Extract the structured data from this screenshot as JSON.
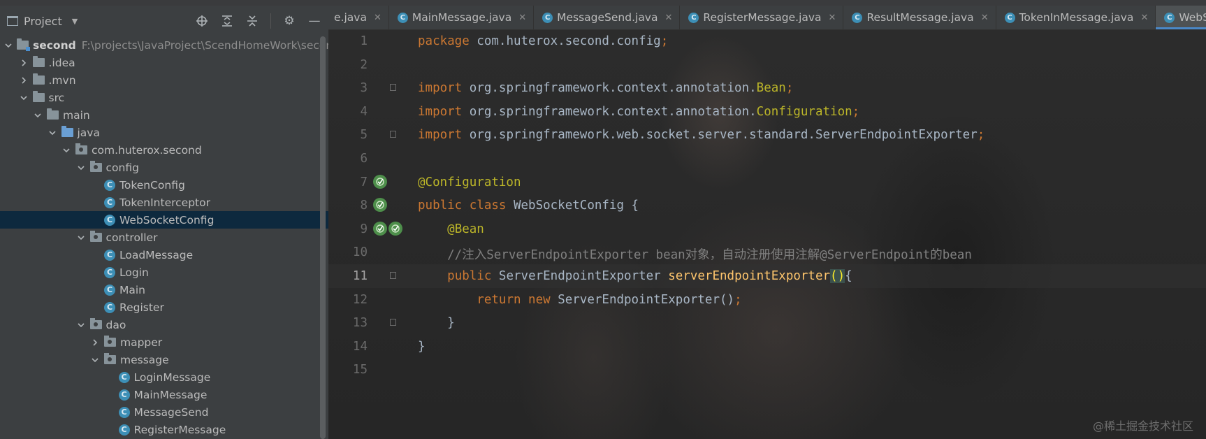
{
  "project_panel": {
    "title": "Project",
    "tree": [
      {
        "label": "second",
        "path": "F:\\projects\\JavaProject\\ScendHomeWork\\second",
        "depth": 0,
        "icon": "module-folder",
        "expanded": true,
        "bold": true
      },
      {
        "label": ".idea",
        "depth": 1,
        "icon": "folder",
        "expanded": false
      },
      {
        "label": ".mvn",
        "depth": 1,
        "icon": "folder",
        "expanded": false
      },
      {
        "label": "src",
        "depth": 1,
        "icon": "folder",
        "expanded": true
      },
      {
        "label": "main",
        "depth": 2,
        "icon": "folder",
        "expanded": true
      },
      {
        "label": "java",
        "depth": 3,
        "icon": "source-folder",
        "expanded": true
      },
      {
        "label": "com.huterox.second",
        "depth": 4,
        "icon": "package",
        "expanded": true
      },
      {
        "label": "config",
        "depth": 5,
        "icon": "package",
        "expanded": true
      },
      {
        "label": "TokenConfig",
        "depth": 6,
        "icon": "class"
      },
      {
        "label": "TokenInterceptor",
        "depth": 6,
        "icon": "class"
      },
      {
        "label": "WebSocketConfig",
        "depth": 6,
        "icon": "class",
        "selected": true
      },
      {
        "label": "controller",
        "depth": 5,
        "icon": "package",
        "expanded": true
      },
      {
        "label": "LoadMessage",
        "depth": 6,
        "icon": "class"
      },
      {
        "label": "Login",
        "depth": 6,
        "icon": "class"
      },
      {
        "label": "Main",
        "depth": 6,
        "icon": "class"
      },
      {
        "label": "Register",
        "depth": 6,
        "icon": "class"
      },
      {
        "label": "dao",
        "depth": 5,
        "icon": "package",
        "expanded": true
      },
      {
        "label": "mapper",
        "depth": 6,
        "icon": "package",
        "expanded": false
      },
      {
        "label": "message",
        "depth": 6,
        "icon": "package",
        "expanded": true
      },
      {
        "label": "LoginMessage",
        "depth": 7,
        "icon": "class"
      },
      {
        "label": "MainMessage",
        "depth": 7,
        "icon": "class"
      },
      {
        "label": "MessageSend",
        "depth": 7,
        "icon": "class"
      },
      {
        "label": "RegisterMessage",
        "depth": 7,
        "icon": "class"
      }
    ]
  },
  "editor": {
    "tabs": [
      {
        "label": "e.java",
        "cut": true
      },
      {
        "label": "MainMessage.java"
      },
      {
        "label": "MessageSend.java"
      },
      {
        "label": "RegisterMessage.java"
      },
      {
        "label": "ResultMessage.java"
      },
      {
        "label": "TokenInMessage.java"
      },
      {
        "label": "WebSocketC",
        "active": true
      }
    ],
    "code": [
      {
        "n": "1",
        "parts": [
          [
            "kw",
            "package "
          ],
          [
            "tp",
            "com.huterox.second.config"
          ],
          [
            "kw",
            ";"
          ]
        ]
      },
      {
        "n": "2",
        "parts": []
      },
      {
        "n": "3",
        "fold": true,
        "parts": [
          [
            "kw",
            "import "
          ],
          [
            "tp",
            "org.springframework.context.annotation."
          ],
          [
            "ann",
            "Bean"
          ],
          [
            "kw",
            ";"
          ]
        ]
      },
      {
        "n": "4",
        "parts": [
          [
            "kw",
            "import "
          ],
          [
            "tp",
            "org.springframework.context.annotation."
          ],
          [
            "ann",
            "Configuration"
          ],
          [
            "kw",
            ";"
          ]
        ]
      },
      {
        "n": "5",
        "fold": true,
        "parts": [
          [
            "kw",
            "import "
          ],
          [
            "tp",
            "org.springframework.web.socket.server.standard.ServerEndpointExporter"
          ],
          [
            "kw",
            ";"
          ]
        ]
      },
      {
        "n": "6",
        "parts": []
      },
      {
        "n": "7",
        "gutter": "config",
        "parts": [
          [
            "ann",
            "@Configuration"
          ]
        ]
      },
      {
        "n": "8",
        "gutter": "bean-class",
        "parts": [
          [
            "kw",
            "public class "
          ],
          [
            "tp",
            "WebSocketConfig {"
          ]
        ]
      },
      {
        "n": "9",
        "gutter": "method",
        "parts": [
          [
            "tp",
            "    "
          ],
          [
            "ann",
            "@Bean"
          ]
        ]
      },
      {
        "n": "10",
        "parts": [
          [
            "cm",
            "    //注入ServerEndpointExporter bean对象，自动注册使用注解@ServerEndpoint的bean"
          ]
        ]
      },
      {
        "n": "11",
        "fold": true,
        "current": true,
        "parts": [
          [
            "tp",
            "    "
          ],
          [
            "kw",
            "public "
          ],
          [
            "tp",
            "ServerEndpointExporter "
          ],
          [
            "fn",
            "serverEndpointExporter"
          ],
          [
            "hl",
            "()"
          ],
          [
            "tp",
            "{"
          ]
        ]
      },
      {
        "n": "12",
        "parts": [
          [
            "tp",
            "        "
          ],
          [
            "kw",
            "return new "
          ],
          [
            "tp",
            "ServerEndpointExporter()"
          ],
          [
            "kw",
            ";"
          ]
        ]
      },
      {
        "n": "13",
        "fold": true,
        "parts": [
          [
            "tp",
            "    }"
          ]
        ]
      },
      {
        "n": "14",
        "parts": [
          [
            "tp",
            "}"
          ]
        ]
      },
      {
        "n": "15",
        "parts": []
      }
    ],
    "watermark": "@稀土掘金技术社区"
  }
}
